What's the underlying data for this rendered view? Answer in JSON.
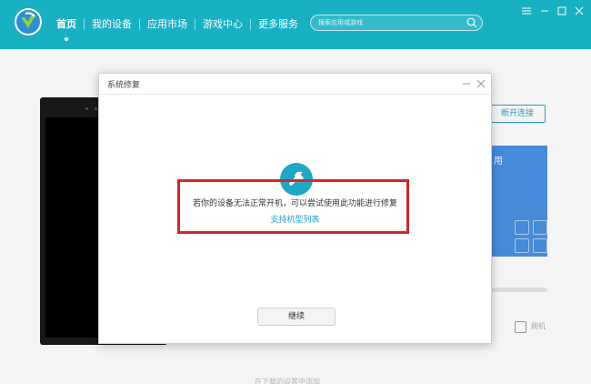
{
  "nav": {
    "items": [
      {
        "label": "首页",
        "active": true
      },
      {
        "label": "我的设备"
      },
      {
        "label": "应用市场"
      },
      {
        "label": "游戏中心"
      },
      {
        "label": "更多服务"
      }
    ]
  },
  "search": {
    "placeholder": "搜索应用或游戏"
  },
  "background": {
    "disconnect_label": "断开连接",
    "card_text": "用",
    "right_text": "刷机",
    "bottom_text": "在下载的设置中添加"
  },
  "dialog": {
    "title": "系统修复",
    "message": "若你的设备无法正常开机，可以尝试使用此功能进行修复",
    "link": "支持机型列表",
    "continue_label": "继续"
  },
  "colors": {
    "topbar": "#18b1c2",
    "accent": "#1fa7c7",
    "highlight": "#d6242a",
    "link": "#1f9ed1"
  },
  "icons": {
    "logo": "app-logo-icon",
    "search": "search-icon",
    "menu": "menu-icon",
    "minimize": "minimize-icon",
    "maximize": "maximize-icon",
    "close": "close-icon",
    "wrench": "wrench-icon"
  }
}
